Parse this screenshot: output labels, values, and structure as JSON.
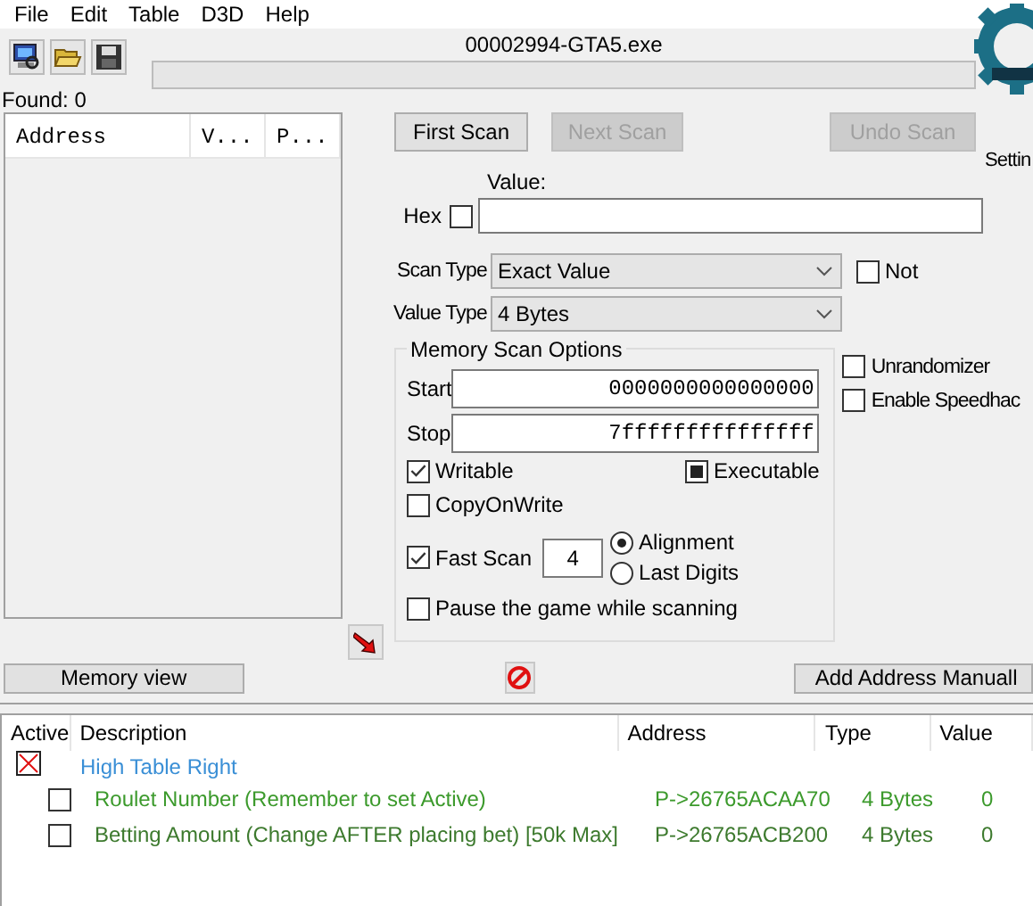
{
  "menu": [
    "File",
    "Edit",
    "Table",
    "D3D",
    "Help"
  ],
  "process_title": "00002994-GTA5.exe",
  "progress": {
    "level": 0
  },
  "found": "Found: 0",
  "results_columns": [
    "Address",
    "V...",
    "P..."
  ],
  "scan_buttons": [
    {
      "label": "First Scan",
      "disabled": false
    },
    {
      "label": "Next Scan",
      "disabled": true
    },
    {
      "label": "Undo Scan",
      "disabled": true
    }
  ],
  "settings_label": "Settin",
  "value": {
    "label": "Value:",
    "hex_label": "Hex",
    "hex_checked": false
  },
  "scan_type": {
    "label": "Scan Type",
    "value": "Exact Value"
  },
  "not_option": {
    "label": "Not",
    "checked": false
  },
  "value_type": {
    "label": "Value Type",
    "value": "4 Bytes"
  },
  "memory_scan_options": {
    "title": "Memory Scan Options",
    "start_label": "Start",
    "start": "0000000000000000",
    "stop_label": "Stop",
    "stop": "7fffffffffffffff",
    "flags": [
      {
        "kind": "checkbox",
        "label": "Writable",
        "checked": true
      },
      {
        "kind": "tristate",
        "label": "Executable",
        "indeterminate": true
      },
      {
        "kind": "checkbox",
        "label": "CopyOnWrite",
        "checked": false
      }
    ],
    "fast_scan": {
      "label": "Fast Scan",
      "checked": true,
      "value": "4"
    },
    "alignment_options": [
      {
        "label": "Alignment",
        "selected": true
      },
      {
        "label": "Last Digits",
        "selected": false
      }
    ],
    "pause": {
      "label": "Pause the game while scanning",
      "checked": false
    }
  },
  "extra_options": [
    {
      "label": "Unrandomizer",
      "checked": false
    },
    {
      "label": "Enable Speedhac",
      "checked": false
    }
  ],
  "memory_view_button": "Memory view",
  "add_address_button": "Add Address Manuall",
  "table": {
    "columns": [
      "Active",
      "Description",
      "Address",
      "Type",
      "Value"
    ],
    "rows": [
      {
        "kind": "group",
        "description": "High Table Right",
        "color": "#3a8fd6"
      },
      {
        "kind": "entry",
        "active": false,
        "description": "Roulet Number (Remember to set Active)",
        "address": "P->26765ACAA70",
        "type": "4 Bytes",
        "value": "0",
        "color": "#3c9a2c"
      },
      {
        "kind": "entry",
        "active": false,
        "description": "Betting Amount (Change AFTER placing bet)  [50k Max]",
        "address": "P->26765ACB200",
        "type": "4 Bytes",
        "value": "0",
        "color": "#3d7a2e"
      }
    ]
  }
}
